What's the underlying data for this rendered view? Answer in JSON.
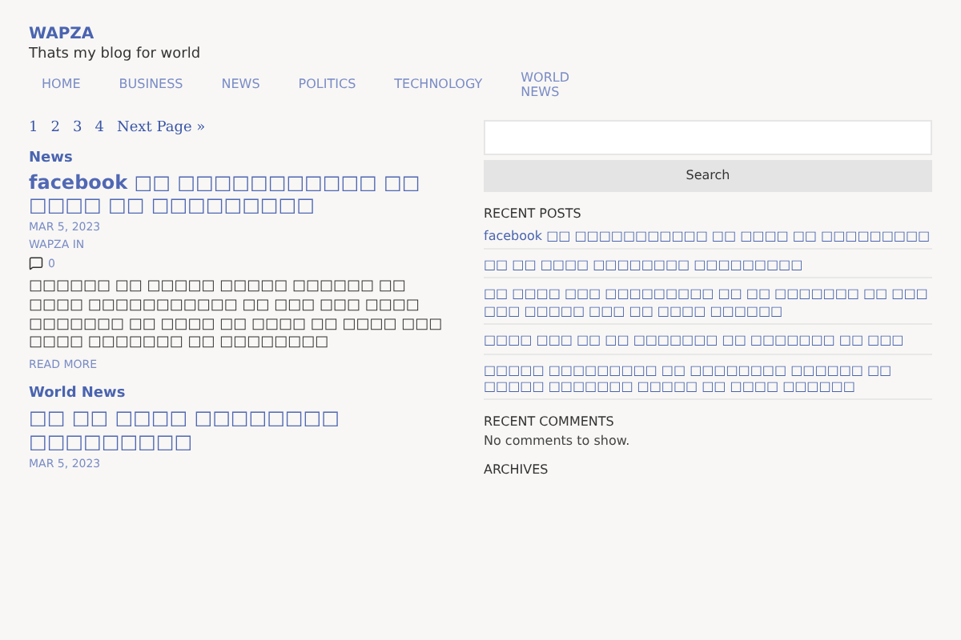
{
  "site": {
    "title": "WAPZA",
    "tagline": "Thats my blog for world"
  },
  "nav": [
    "HOME",
    "BUSINESS",
    "NEWS",
    "POLITICS",
    "TECHNOLOGY",
    "WORLD NEWS"
  ],
  "pagination": {
    "pages": [
      "1",
      "2",
      "3",
      "4"
    ],
    "next": "Next Page »"
  },
  "posts": [
    {
      "category": "News",
      "title": "facebook □□ □□□□□□□□□□□ □□ □□□□ □□ □□□□□□□□□",
      "date": "MAR 5, 2023",
      "author": "WAPZA IN",
      "comments": "0",
      "excerpt": "□□□□□□ □□ □□□□□ □□□□□ □□□□□□ □□ □□□□ □□□□□□□□□□□ □□ □□□ □□□ □□□□ □□□□□□□ □□ □□□□ □□ □□□□ □□ □□□□ □□□ □□□□ □□□□□□□ □□ □□□□□□□□",
      "read_more": "READ MORE"
    },
    {
      "category": "World News",
      "title": "□□ □□ □□□□ □□□□□□□□ □□□□□□□□□",
      "date": "MAR 5, 2023"
    }
  ],
  "search": {
    "button": "Search"
  },
  "recent_posts": {
    "heading": "RECENT POSTS",
    "items": [
      "facebook □□ □□□□□□□□□□□ □□ □□□□ □□ □□□□□□□□□",
      "□□ □□ □□□□ □□□□□□□□ □□□□□□□□□",
      "□□ □□□□ □□□ □□□□□□□□□ □□ □□ □□□□□□□ □□ □□□ □□□ □□□□□ □□□ □□ □□□□ □□□□□□",
      "□□□□ □□□ □□ □□ □□□□□□□ □□ □□□□□□□ □□ □□□",
      "□□□□□ □□□□□□□□□ □□ □□□□□□□□ □□□□□□ □□ □□□□□ □□□□□□□ □□□□□ □□ □□□□ □□□□□□"
    ]
  },
  "recent_comments": {
    "heading": "RECENT COMMENTS",
    "empty": "No comments to show."
  },
  "archives": {
    "heading": "ARCHIVES"
  }
}
